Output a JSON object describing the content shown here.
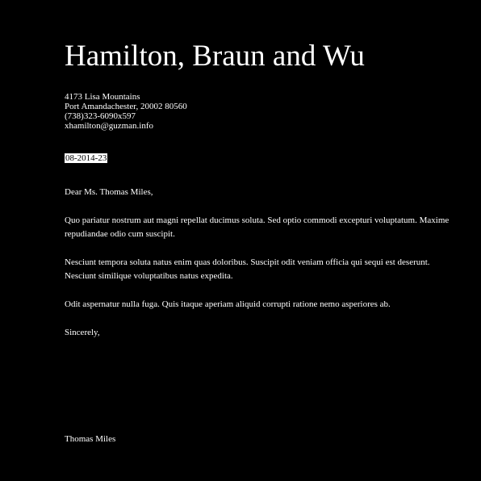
{
  "letter": {
    "company_name": "Hamilton, Braun and Wu",
    "address": {
      "street": "4173 Lisa Mountains",
      "city_line": "Port Amandachester, 20002 80560",
      "phone": "(738)323-6090x597",
      "email": "xhamilton@guzman.info"
    },
    "date": "08-2014-23",
    "salutation": "Dear Ms. Thomas Miles,",
    "paragraphs": [
      "Quo pariatur nostrum aut magni repellat ducimus soluta. Sed optio commodi excepturi voluptatum. Maxime repudiandae odio cum suscipit.",
      "Nesciunt tempora soluta natus enim quas doloribus. Suscipit odit veniam officia qui sequi est deserunt. Nesciunt similique voluptatibus natus expedita.",
      "Odit aspernatur nulla fuga. Quis itaque aperiam aliquid corrupti ratione nemo asperiores ab."
    ],
    "closing": "Sincerely,",
    "signature": "Thomas Miles"
  },
  "colors": {
    "background": "#000000",
    "text": "#ffffff",
    "date_highlight_background": "#ffffff",
    "date_highlight_text": "#000000"
  }
}
